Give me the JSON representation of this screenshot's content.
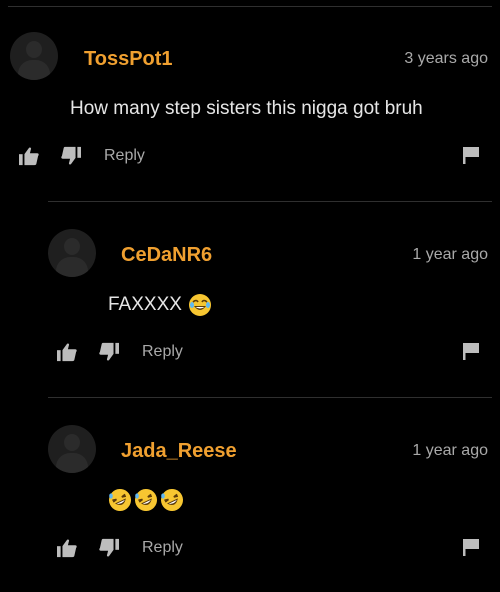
{
  "comments": [
    {
      "username": "TossPot1",
      "time": "3 years ago",
      "text": "How many step sisters this nigga got bruh",
      "reply_label": "Reply",
      "avatar_icon": "default-avatar-icon"
    },
    {
      "username": "CeDaNR6",
      "time": "1 year ago",
      "text": "FAXXXX",
      "emoji": "face-with-tears-of-joy",
      "reply_label": "Reply",
      "avatar_icon": "default-avatar-icon"
    },
    {
      "username": "Jada_Reese",
      "time": "1 year ago",
      "emojis": [
        "rolling-on-the-floor-laughing",
        "rolling-on-the-floor-laughing",
        "rolling-on-the-floor-laughing"
      ],
      "reply_label": "Reply",
      "avatar_icon": "default-avatar-icon"
    }
  ],
  "colors": {
    "background": "#000000",
    "username": "#f0a030",
    "muted": "#a9a9a9",
    "text": "#e6e6e6"
  }
}
